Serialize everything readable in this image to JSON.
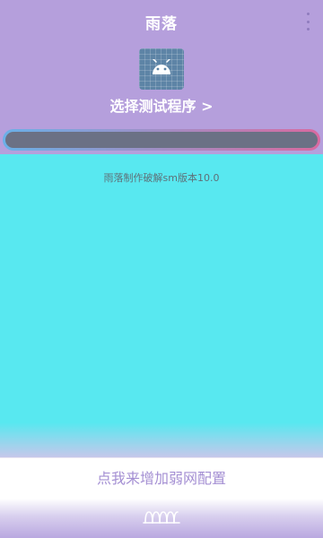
{
  "header": {
    "title": "雨落",
    "menu_icon": "more-vertical-icon",
    "app_icon": "android-icon",
    "select_program_label": "选择测试程序 >"
  },
  "progress": {
    "value": 0
  },
  "body": {
    "text": "雨落制作破解sm版本10.0"
  },
  "footer": {
    "weak_net_label": "点我来增加弱网配置",
    "logo_icon": "brand-logo-icon"
  },
  "colors": {
    "header_bg": "#b59fdc",
    "body_bg": "#58e8f0",
    "accent": "#a48fd3"
  }
}
